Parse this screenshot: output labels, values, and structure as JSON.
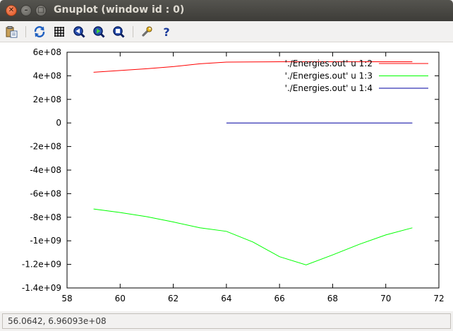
{
  "window": {
    "title": "Gnuplot (window id : 0)"
  },
  "toolbar": {
    "buttons": [
      {
        "name": "copy-to-clipboard-button",
        "icon": "clipboard-icon"
      },
      {
        "name": "replot-button",
        "icon": "refresh-icon"
      },
      {
        "name": "toggle-grid-button",
        "icon": "grid-icon"
      },
      {
        "name": "previous-zoom-button",
        "icon": "zoom-previous-icon"
      },
      {
        "name": "next-zoom-button",
        "icon": "zoom-next-icon"
      },
      {
        "name": "autoscale-button",
        "icon": "autoscale-icon"
      },
      {
        "name": "options-button",
        "icon": "wrench-icon"
      },
      {
        "name": "help-button",
        "icon": "help-icon"
      }
    ]
  },
  "status": {
    "text": "56.0642,  6.96093e+08"
  },
  "chart_data": {
    "type": "line",
    "title": "",
    "xlabel": "",
    "ylabel": "",
    "xlim": [
      58,
      72
    ],
    "ylim": [
      -1400000000,
      600000000
    ],
    "xticks": [
      58,
      60,
      62,
      64,
      66,
      68,
      70,
      72
    ],
    "xtick_labels": [
      "58",
      "60",
      "62",
      "64",
      "66",
      "68",
      "70",
      "72"
    ],
    "yticks": [
      600000000,
      400000000,
      200000000,
      0,
      -200000000,
      -400000000,
      -600000000,
      -800000000,
      -1000000000,
      -1200000000,
      -1400000000
    ],
    "ytick_labels": [
      "6e+08",
      "4e+08",
      "2e+08",
      "0",
      "-2e+08",
      "-4e+08",
      "-6e+08",
      "-8e+08",
      "-1e+09",
      "-1.2e+09",
      "-1.4e+09"
    ],
    "grid": false,
    "legend_position": "top-right",
    "series": [
      {
        "name": "'./Energies.out' u 1:2",
        "color": "#ff0000",
        "x": [
          59,
          60,
          61,
          62,
          63,
          64,
          65,
          66,
          67,
          68,
          69,
          70,
          71
        ],
        "y": [
          430000000,
          445000000,
          460000000,
          478000000,
          502000000,
          516000000,
          518000000,
          519000000,
          519000000,
          519000000,
          519000000,
          519000000,
          519000000
        ]
      },
      {
        "name": "'./Energies.out' u 1:3",
        "color": "#00ff00",
        "x": [
          59,
          60,
          61,
          62,
          63,
          64,
          65,
          66,
          67,
          68,
          69,
          70,
          71
        ],
        "y": [
          -730000000,
          -760000000,
          -795000000,
          -840000000,
          -890000000,
          -920000000,
          -1010000000,
          -1135000000,
          -1205000000,
          -1120000000,
          -1030000000,
          -950000000,
          -890000000
        ]
      },
      {
        "name": "'./Energies.out' u 1:4",
        "color": "#0000a0",
        "x": [
          64,
          65,
          66,
          67,
          68,
          69,
          70,
          71
        ],
        "y": [
          0,
          0,
          0,
          0,
          0,
          0,
          0,
          0
        ]
      }
    ]
  }
}
